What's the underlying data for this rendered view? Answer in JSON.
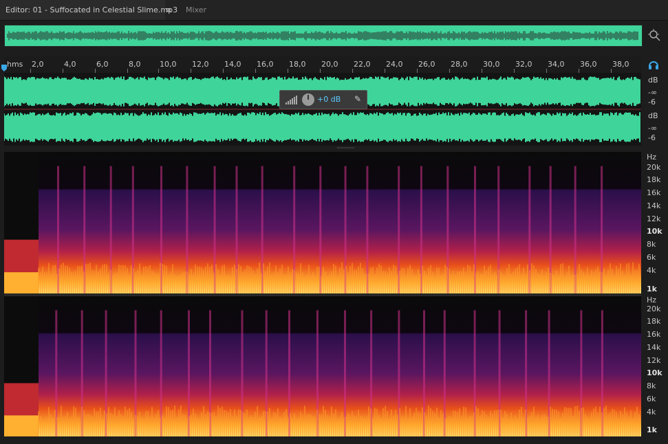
{
  "tabs": {
    "editor_label": "Editor: 01 - Suffocated in Celestial Slime.mp3",
    "menu_glyph": "≡",
    "mixer_label": "Mixer"
  },
  "ruler": {
    "unit": "hms",
    "ticks": [
      "2,0",
      "4,0",
      "6,0",
      "8,0",
      "10,0",
      "12,0",
      "14,0",
      "16,0",
      "18,0",
      "20,0",
      "22,0",
      "24,0",
      "26,0",
      "28,0",
      "30,0",
      "32,0",
      "34,0",
      "36,0",
      "38,0"
    ]
  },
  "hud": {
    "gain": "+0 dB"
  },
  "db_scale": {
    "top": [
      "dB",
      "-∞",
      "-6"
    ],
    "bottom": [
      "dB",
      "-∞",
      "-6"
    ]
  },
  "hz_scale": {
    "labels": [
      "Hz",
      "20k",
      "18k",
      "16k",
      "14k",
      "12k",
      "10k",
      "8k",
      "6k",
      "4k",
      "1k"
    ]
  },
  "colors": {
    "waveform": "#3fd49a",
    "accent": "#3ba7e6",
    "spectral_low": "#ffd24a",
    "spectral_high": "#3b0f5a"
  },
  "icons": {
    "zoom": "zoom-to-selection-icon",
    "headphones": "headphones-icon",
    "pin": "pin-icon"
  }
}
